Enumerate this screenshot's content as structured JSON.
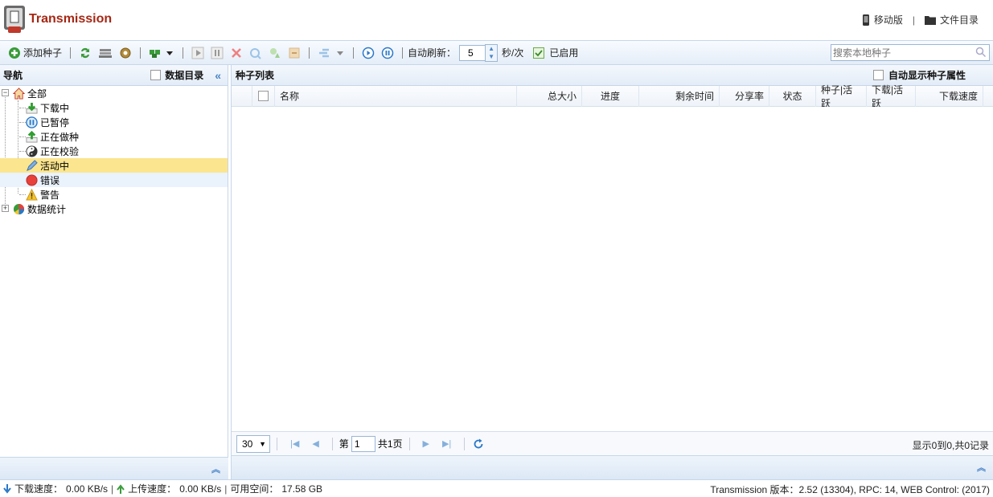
{
  "header": {
    "app_title": "Transmission",
    "mobile_link": "移动版",
    "separator": "|",
    "files_link": "文件目录"
  },
  "toolbar": {
    "add_torrent_label": "添加种子",
    "auto_refresh_label": "自动刷新：",
    "refresh_interval": "5",
    "interval_unit": "秒/次",
    "enabled_label": "已启用",
    "enabled_checked": true,
    "search_placeholder": "搜索本地种子"
  },
  "nav": {
    "title": "导航",
    "data_dir_label": "数据目录",
    "items": [
      {
        "label": "全部",
        "icon": "home-icon"
      },
      {
        "label": "下载中",
        "icon": "download-arrow-icon"
      },
      {
        "label": "已暂停",
        "icon": "pause-circle-icon"
      },
      {
        "label": "正在做种",
        "icon": "upload-arrow-icon"
      },
      {
        "label": "正在校验",
        "icon": "yin-yang-icon"
      },
      {
        "label": "活动中",
        "icon": "pencil-icon"
      },
      {
        "label": "错误",
        "icon": "error-circle-icon"
      },
      {
        "label": "警告",
        "icon": "warning-icon"
      },
      {
        "label": "数据统计",
        "icon": "pie-chart-icon"
      }
    ],
    "selected_item": "活动中"
  },
  "torrents": {
    "title": "种子列表",
    "auto_show_label": "自动显示种子属性",
    "columns": [
      "名称",
      "总大小",
      "进度",
      "剩余时间",
      "分享率",
      "状态",
      "种子|活跃",
      "下载|活跃",
      "下载速度"
    ],
    "rows": []
  },
  "pager": {
    "page_size": "30",
    "page_prefix": "第",
    "current_page": "1",
    "total_pages": "共1页",
    "summary": "显示0到0,共0记录"
  },
  "status": {
    "download_label": "下载速度：",
    "download_value": "0.00 KB/s",
    "upload_label": "上传速度：",
    "upload_value": "0.00 KB/s",
    "free_space_label": "可用空间：",
    "free_space_value": "17.58 GB",
    "sep": "|",
    "version": "Transmission 版本：2.52 (13304), RPC: 14, WEB Control: (2017)"
  },
  "colors": {
    "accent": "#4a86c8",
    "title": "#a52714",
    "selected_row": "#fbe58e",
    "border": "#c5d6ea"
  }
}
